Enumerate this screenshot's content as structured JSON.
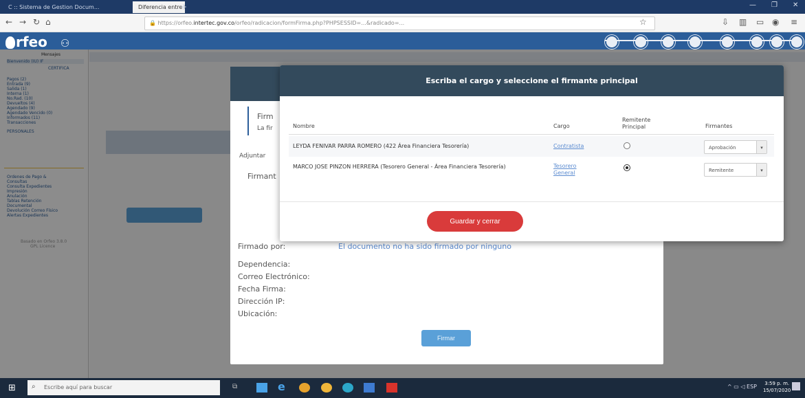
{
  "browser": {
    "tabs": [
      {
        "label": "C :: Sistema de Gestion Docum..."
      },
      {
        "label": "Diferencia entre Manual e Inst..."
      }
    ],
    "new_tab": "+",
    "url_prefix": "https://orfeo.",
    "url_domain": "intertec.gov.co",
    "url_rest": "/orfeo/radicacion/formFirma.php?PHPSESSID=...&radicado=..."
  },
  "app": {
    "logo_text": "rfeo",
    "header_icon_count": 8
  },
  "sidebar": {
    "items": [
      "Mensajes",
      "Bienvenido (IU) IF",
      "CERTIFICA",
      "Pagos (2)",
      "Entrada (9)",
      "Salida (1)",
      "Interna (1)",
      "No.Rad. (10)",
      "Devueltos (4)",
      "Agendado (9)",
      "Agendado Vencido (0)",
      "Informados (11)",
      "Transacciones",
      "PERSONALES",
      "Ordenes de Pago &",
      "Consultas",
      "Consulta Expedientes",
      "Impresión",
      "Anulación",
      "Tablas Retención",
      "Documental",
      "Devolución Correo Físico",
      "Alertas Expedientes",
      "Basado en Orfeo 3.8.0",
      "GPL Licence"
    ]
  },
  "modal1": {
    "firmado_label": "Firmado por:",
    "firmado_value": "El documento no ha sido firmado por ninguno",
    "dependencia_label": "Dependencia:",
    "correo_label": "Correo Electrónico:",
    "fecha_label": "Fecha Firma:",
    "ip_label": "Dirección IP:",
    "ubicacion_label": "Ubicación:",
    "firmar_button": "Firmar",
    "left_text1": "Firm",
    "left_text2": "La fir",
    "left_text3": "Firmant",
    "left_text4": "Adjuntar"
  },
  "modal2": {
    "title": "Escriba el cargo y seleccione el firmante principal",
    "headers": {
      "nombre": "Nombre",
      "cargo": "Cargo",
      "remitente": "Remitente Principal",
      "firmantes": "Firmantes"
    },
    "rows": [
      {
        "nombre": "LEYDA FENIVAR PARRA ROMERO (422 Área Financiera Tesorería)",
        "cargo": "Contratista",
        "remitente_checked": false,
        "firmante": "Aprobación"
      },
      {
        "nombre": "MARCO JOSE PINZON HERRERA (Tesorero General - Área Financiera Tesorería)",
        "cargo": "Tesorero General",
        "remitente_checked": true,
        "firmante": "Remitente"
      }
    ],
    "save_button": "Guardar y cerrar"
  },
  "taskbar": {
    "search_placeholder": "Escribe aquí para buscar",
    "time": "3:59 p. m.",
    "date": "15/07/2020",
    "lang": "ESP"
  },
  "colors": {
    "header_blue": "#2b5d99",
    "modal_head": "#334a5c",
    "save_red": "#d93b3b",
    "firmar_blue": "#5aa0d8"
  }
}
